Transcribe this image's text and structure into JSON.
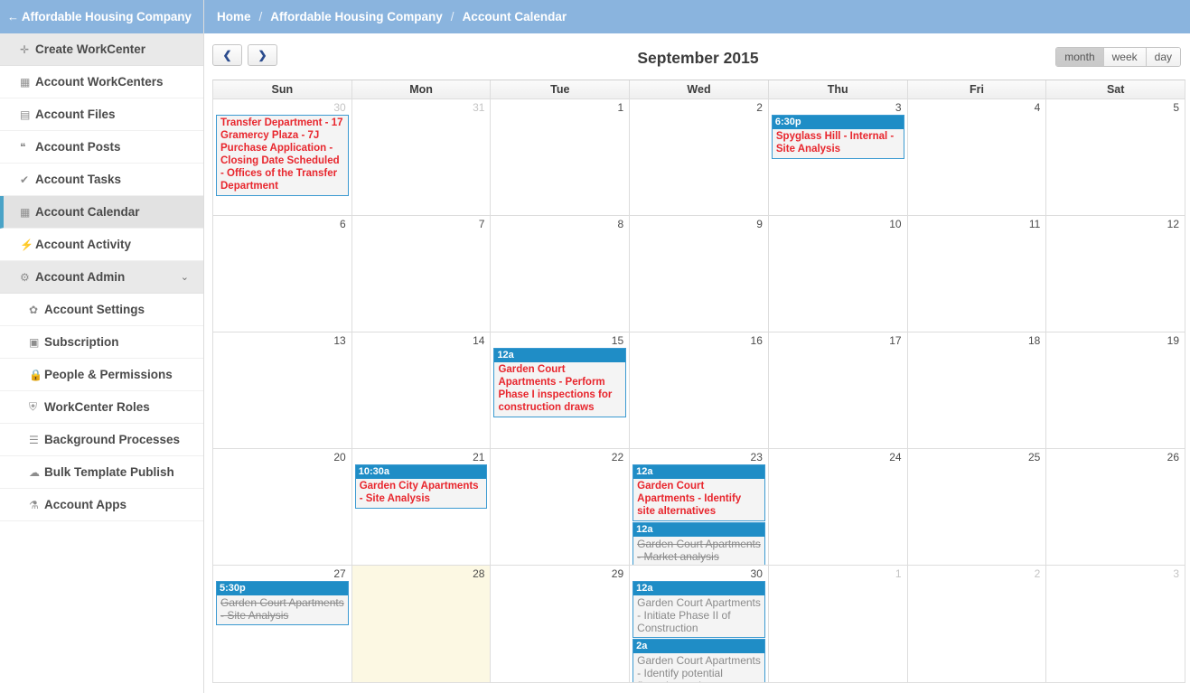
{
  "sidebar": {
    "header": {
      "title": "Affordable Housing Company",
      "back_icon": "←"
    },
    "items": [
      {
        "label": "Create WorkCenter",
        "icon": "✛",
        "icon_name": "plus-icon",
        "state": "shaded",
        "level": 1
      },
      {
        "label": "Account WorkCenters",
        "icon": "▦",
        "icon_name": "grid-icon",
        "state": "normal",
        "level": 1
      },
      {
        "label": "Account Files",
        "icon": "▤",
        "icon_name": "file-icon",
        "state": "normal",
        "level": 1
      },
      {
        "label": "Account Posts",
        "icon": "❝",
        "icon_name": "comments-icon",
        "state": "normal",
        "level": 1
      },
      {
        "label": "Account Tasks",
        "icon": "✔",
        "icon_name": "check-icon",
        "state": "normal",
        "level": 1
      },
      {
        "label": "Account Calendar",
        "icon": "▦",
        "icon_name": "calendar-icon",
        "state": "active",
        "level": 1
      },
      {
        "label": "Account Activity",
        "icon": "⚡",
        "icon_name": "bolt-icon",
        "state": "normal",
        "level": 1
      },
      {
        "label": "Account Admin",
        "icon": "⚙",
        "icon_name": "cogs-icon",
        "state": "shaded",
        "level": 1,
        "chevron": "⌄"
      },
      {
        "label": "Account Settings",
        "icon": "✿",
        "icon_name": "gear-icon",
        "state": "normal",
        "level": 2
      },
      {
        "label": "Subscription",
        "icon": "▣",
        "icon_name": "money-icon",
        "state": "normal",
        "level": 2
      },
      {
        "label": "People & Permissions",
        "icon": "🔒",
        "icon_name": "lock-icon",
        "state": "normal",
        "level": 2
      },
      {
        "label": "WorkCenter Roles",
        "icon": "⛨",
        "icon_name": "shield-icon",
        "state": "normal",
        "level": 2
      },
      {
        "label": "Background Processes",
        "icon": "☰",
        "icon_name": "tasks-icon",
        "state": "normal",
        "level": 2
      },
      {
        "label": "Bulk Template Publish",
        "icon": "☁",
        "icon_name": "cloud-upload-icon",
        "state": "normal",
        "level": 2
      },
      {
        "label": "Account Apps",
        "icon": "⚗",
        "icon_name": "flask-icon",
        "state": "normal",
        "level": 2
      }
    ]
  },
  "breadcrumb": {
    "home": "Home",
    "sep1": "/",
    "account": "Affordable Housing Company",
    "sep2": "/",
    "page": "Account Calendar"
  },
  "toolbar": {
    "prev_label": "❮",
    "next_label": "❯",
    "title": "September 2015",
    "views": [
      {
        "label": "month",
        "selected": true
      },
      {
        "label": "week",
        "selected": false
      },
      {
        "label": "day",
        "selected": false
      }
    ]
  },
  "calendar": {
    "dow": [
      "Sun",
      "Mon",
      "Tue",
      "Wed",
      "Thu",
      "Fri",
      "Sat"
    ],
    "weeks": [
      [
        {
          "num": "30",
          "other": true,
          "today": false,
          "events": [
            {
              "time": null,
              "title": "Transfer Department - 17 Gramercy Plaza - 7J Purchase Application - Closing Date Scheduled - Offices of the Transfer Department",
              "style": "red"
            }
          ]
        },
        {
          "num": "31",
          "other": true,
          "today": false,
          "events": []
        },
        {
          "num": "1",
          "other": false,
          "today": false,
          "events": []
        },
        {
          "num": "2",
          "other": false,
          "today": false,
          "events": []
        },
        {
          "num": "3",
          "other": false,
          "today": false,
          "events": [
            {
              "time": "6:30p",
              "title": "Spyglass Hill - Internal - Site Analysis",
              "style": "red"
            }
          ]
        },
        {
          "num": "4",
          "other": false,
          "today": false,
          "events": []
        },
        {
          "num": "5",
          "other": false,
          "today": false,
          "events": []
        }
      ],
      [
        {
          "num": "6",
          "other": false,
          "today": false,
          "events": []
        },
        {
          "num": "7",
          "other": false,
          "today": false,
          "events": []
        },
        {
          "num": "8",
          "other": false,
          "today": false,
          "events": []
        },
        {
          "num": "9",
          "other": false,
          "today": false,
          "events": []
        },
        {
          "num": "10",
          "other": false,
          "today": false,
          "events": []
        },
        {
          "num": "11",
          "other": false,
          "today": false,
          "events": []
        },
        {
          "num": "12",
          "other": false,
          "today": false,
          "events": []
        }
      ],
      [
        {
          "num": "13",
          "other": false,
          "today": false,
          "events": []
        },
        {
          "num": "14",
          "other": false,
          "today": false,
          "events": []
        },
        {
          "num": "15",
          "other": false,
          "today": false,
          "events": [
            {
              "time": "12a",
              "title": "Garden Court Apartments - Perform Phase I inspections for construction draws",
              "style": "red"
            }
          ]
        },
        {
          "num": "16",
          "other": false,
          "today": false,
          "events": []
        },
        {
          "num": "17",
          "other": false,
          "today": false,
          "events": []
        },
        {
          "num": "18",
          "other": false,
          "today": false,
          "events": []
        },
        {
          "num": "19",
          "other": false,
          "today": false,
          "events": []
        }
      ],
      [
        {
          "num": "20",
          "other": false,
          "today": false,
          "events": []
        },
        {
          "num": "21",
          "other": false,
          "today": false,
          "events": [
            {
              "time": "10:30a",
              "title": "Garden City Apartments - Site Analysis",
              "style": "red"
            }
          ]
        },
        {
          "num": "22",
          "other": false,
          "today": false,
          "events": []
        },
        {
          "num": "23",
          "other": false,
          "today": false,
          "events": [
            {
              "time": "12a",
              "title": "Garden Court Apartments - Identify site alternatives",
              "style": "red"
            },
            {
              "time": "12a",
              "title": "Garden Court Apartments - Market analysis",
              "style": "done"
            }
          ]
        },
        {
          "num": "24",
          "other": false,
          "today": false,
          "events": []
        },
        {
          "num": "25",
          "other": false,
          "today": false,
          "events": []
        },
        {
          "num": "26",
          "other": false,
          "today": false,
          "events": []
        }
      ],
      [
        {
          "num": "27",
          "other": false,
          "today": false,
          "events": [
            {
              "time": "5:30p",
              "title": "Garden Court Apartments - Site Analysis",
              "style": "done"
            }
          ]
        },
        {
          "num": "28",
          "other": false,
          "today": true,
          "events": []
        },
        {
          "num": "29",
          "other": false,
          "today": false,
          "events": []
        },
        {
          "num": "30",
          "other": false,
          "today": false,
          "events": [
            {
              "time": "12a",
              "title": "Garden Court Apartments - Initiate Phase II of Construction",
              "style": "muted"
            },
            {
              "time": "2a",
              "title": "Garden Court Apartments - Identify potential financing options",
              "style": "muted"
            }
          ]
        },
        {
          "num": "1",
          "other": true,
          "today": false,
          "events": []
        },
        {
          "num": "2",
          "other": true,
          "today": false,
          "events": []
        },
        {
          "num": "3",
          "other": true,
          "today": false,
          "events": []
        }
      ]
    ]
  },
  "colors": {
    "brand_blue": "#8ab4de",
    "event_blue": "#1f8dc6",
    "event_red": "#e8262d",
    "today_bg": "#fcf8e3",
    "active_accent": "#4aa3c7"
  }
}
